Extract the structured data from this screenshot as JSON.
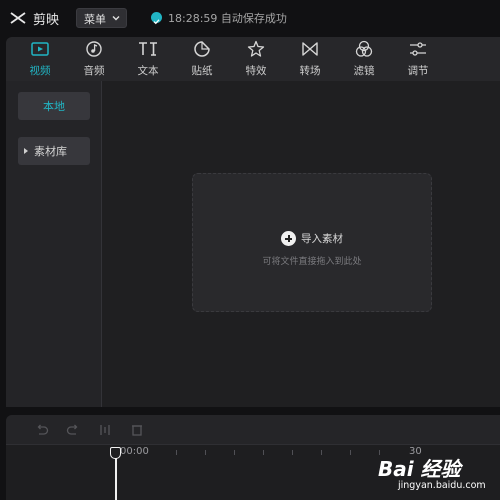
{
  "app": {
    "name": "剪映",
    "logo_icon": "capcut-logo-icon"
  },
  "titlebar": {
    "menu_label": "菜单",
    "menu_icon": "chevron-down-icon",
    "save_time": "18:28:59",
    "save_text": "自动保存成功",
    "save_status": "18:28:59 自动保存成功"
  },
  "toolbar": {
    "active": "视频",
    "accent_color": "#21b5c4",
    "tools": [
      {
        "label": "视频",
        "icon": "video-icon"
      },
      {
        "label": "音频",
        "icon": "music-note-icon"
      },
      {
        "label": "文本",
        "icon": "text-icon"
      },
      {
        "label": "贴纸",
        "icon": "sticker-icon"
      },
      {
        "label": "特效",
        "icon": "sparkle-star-icon"
      },
      {
        "label": "转场",
        "icon": "transition-icon"
      },
      {
        "label": "滤镜",
        "icon": "filter-circles-icon"
      },
      {
        "label": "调节",
        "icon": "sliders-icon"
      }
    ]
  },
  "sidebar": {
    "local_label": "本地",
    "library_label": "素材库"
  },
  "dropzone": {
    "import_label": "导入素材",
    "hint": "可将文件直接拖入到此处"
  },
  "timeline": {
    "buttons": [
      "undo-icon",
      "redo-icon",
      "split-icon",
      "delete-icon"
    ],
    "time_start": "00:00",
    "time_next": "30"
  },
  "watermark": {
    "brand": "Bai 经验",
    "url": "jingyan.baidu.com"
  }
}
